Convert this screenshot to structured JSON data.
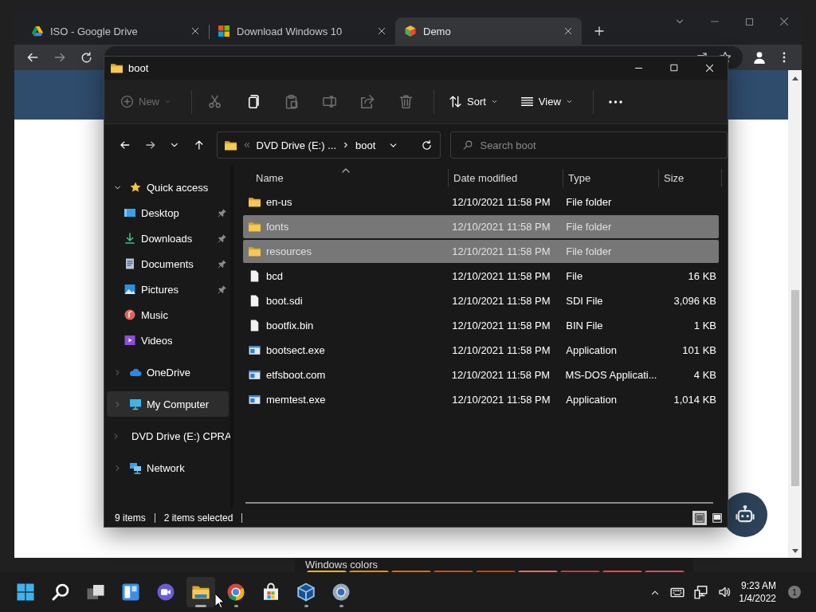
{
  "browser": {
    "tabs": [
      {
        "kind": "drive",
        "title": "ISO - Google Drive",
        "selected": false
      },
      {
        "kind": "windows",
        "title": "Download Windows 10",
        "selected": false
      },
      {
        "kind": "cube",
        "title": "Demo",
        "selected": true
      }
    ]
  },
  "explorer": {
    "title": "boot",
    "toolbar": [
      {
        "kind": "new",
        "label": "New",
        "disabled": true
      },
      {
        "kind": "separator"
      },
      {
        "kind": "cut",
        "disabled": true
      },
      {
        "kind": "copy",
        "disabled": false
      },
      {
        "kind": "paste",
        "disabled": true
      },
      {
        "kind": "rename",
        "disabled": true
      },
      {
        "kind": "share",
        "disabled": true
      },
      {
        "kind": "delete",
        "disabled": true
      },
      {
        "kind": "separator"
      },
      {
        "kind": "sort",
        "label": "Sort",
        "disabled": false
      },
      {
        "kind": "view",
        "label": "View",
        "disabled": false
      },
      {
        "kind": "separator"
      },
      {
        "kind": "more",
        "disabled": false
      }
    ],
    "breadcrumb": [
      "DVD Drive (E:) ...",
      "boot"
    ],
    "search": {
      "placeholder": "Search boot"
    },
    "sidebar": [
      {
        "label": "Quick access",
        "kind": "star",
        "expanded": true,
        "selected": false,
        "children": [
          {
            "label": "Desktop",
            "kind": "desktop",
            "pinned": true,
            "selected": false
          },
          {
            "label": "Downloads",
            "kind": "downloads",
            "pinned": true,
            "selected": false
          },
          {
            "label": "Documents",
            "kind": "documents",
            "pinned": true,
            "selected": false
          },
          {
            "label": "Pictures",
            "kind": "pictures",
            "pinned": true,
            "selected": false
          },
          {
            "label": "Music",
            "kind": "music",
            "pinned": false,
            "selected": false
          },
          {
            "label": "Videos",
            "kind": "videos",
            "pinned": false,
            "selected": false
          }
        ]
      },
      {
        "label": "OneDrive",
        "kind": "cloud",
        "expanded": false,
        "selected": false
      },
      {
        "label": "My Computer",
        "kind": "monitor",
        "expanded": false,
        "selected": true
      },
      {
        "label": "DVD Drive (E:) CPRA",
        "kind": "dvd",
        "expanded": false,
        "selected": false
      },
      {
        "label": "Network",
        "kind": "network",
        "expanded": false,
        "selected": false
      }
    ],
    "columns": [
      {
        "label": "Name",
        "sorted": true
      },
      {
        "label": "Date modified",
        "sorted": false
      },
      {
        "label": "Type",
        "sorted": false
      },
      {
        "label": "Size",
        "sorted": false
      }
    ],
    "rows": [
      {
        "kind": "folder",
        "name": "en-us",
        "date": "12/10/2021 11:58 PM",
        "type": "File folder",
        "selected": false
      },
      {
        "kind": "folder",
        "name": "fonts",
        "date": "12/10/2021 11:58 PM",
        "type": "File folder",
        "selected": true
      },
      {
        "kind": "folder",
        "name": "resources",
        "date": "12/10/2021 11:58 PM",
        "type": "File folder",
        "selected": true
      },
      {
        "kind": "file",
        "name": "bcd",
        "date": "12/10/2021 11:58 PM",
        "type": "File",
        "size": "16 KB",
        "selected": false
      },
      {
        "kind": "file",
        "name": "boot.sdi",
        "date": "12/10/2021 11:58 PM",
        "type": "SDI File",
        "size": "3,096 KB",
        "selected": false
      },
      {
        "kind": "file",
        "name": "bootfix.bin",
        "date": "12/10/2021 11:58 PM",
        "type": "BIN File",
        "size": "1 KB",
        "selected": false
      },
      {
        "kind": "app",
        "name": "bootsect.exe",
        "date": "12/10/2021 11:58 PM",
        "type": "Application",
        "size": "101 KB",
        "selected": false
      },
      {
        "kind": "app",
        "name": "etfsboot.com",
        "date": "12/10/2021 11:58 PM",
        "type": "MS-DOS Applicati...",
        "size": "4 KB",
        "selected": false
      },
      {
        "kind": "app",
        "name": "memtest.exe",
        "date": "12/10/2021 11:58 PM",
        "type": "Application",
        "size": "1,014 KB",
        "selected": false
      }
    ],
    "status": [
      "9 items",
      "2 items selected"
    ],
    "view_modes": [
      {
        "kind": "details",
        "selected": true
      },
      {
        "kind": "tiles",
        "selected": false
      }
    ]
  },
  "colors_panel": {
    "label": "Windows colors",
    "swatches": [
      {
        "color": "#ffb900"
      },
      {
        "color": "#ff8c00"
      },
      {
        "color": "#f7630c"
      },
      {
        "color": "#ca5010"
      },
      {
        "color": "#da3b01"
      },
      {
        "color": "#ef6950"
      },
      {
        "color": "#d13438"
      },
      {
        "color": "#ff4343"
      },
      {
        "color": "#e74856"
      }
    ]
  },
  "taskbar": {
    "apps": [
      {
        "kind": "start",
        "running": false,
        "active": false
      },
      {
        "kind": "search",
        "running": false,
        "active": false
      },
      {
        "kind": "taskview",
        "running": false,
        "active": false
      },
      {
        "kind": "widgets",
        "running": false,
        "active": false
      },
      {
        "kind": "chat",
        "running": false,
        "active": false
      },
      {
        "kind": "explorer",
        "running": true,
        "active": true
      },
      {
        "kind": "chrome",
        "running": true,
        "active": false
      },
      {
        "kind": "store",
        "running": false,
        "active": false
      },
      {
        "kind": "virtualbox",
        "running": true,
        "active": false
      },
      {
        "kind": "settings",
        "running": true,
        "active": false
      }
    ],
    "time": "9:23 AM",
    "date": "1/4/2022",
    "notifications": "1"
  }
}
